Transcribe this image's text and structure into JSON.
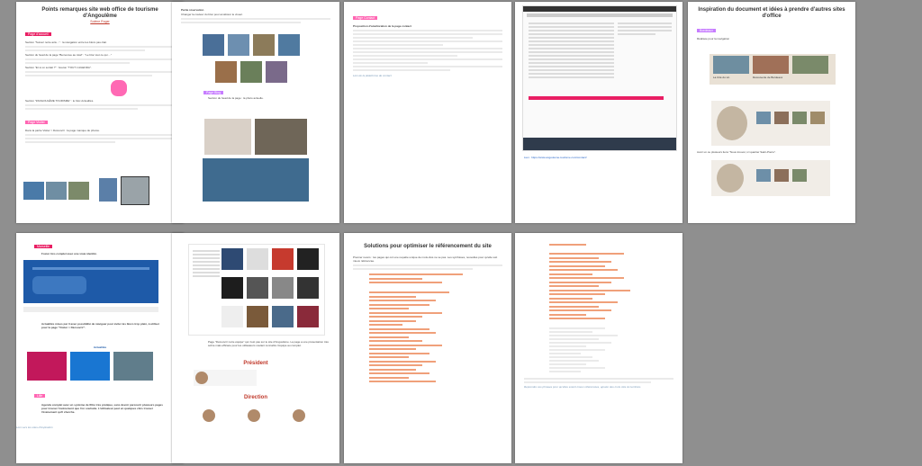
{
  "pages": [
    {
      "title": "Points remarques site web office de tourisme d'Angoulême",
      "author": "Solène Roger",
      "tags": [
        "Page d'accueil",
        "Page Visiter"
      ],
      "paragraphs": [
        "Section \"Suivez notre actu...\" : la navigation entre les blocs pas clair.",
        "Section du head de la page \"Benvenue au total\" : \"Le bloc tout ce qui ...\"",
        "Section \"Et si on sortait ?\" : bouton \"TOUT L'AGENDA\".",
        "Section \"#ANGOULÊME TOURISME\" : le bloc Actualités.",
        "Dans la partie Visiter > Découvrir : la page manque de photos."
      ]
    },
    {
      "heading": "Partie réservation",
      "tag": "Page Blog",
      "paragraphs": [
        "Changer la couleur du bloc pour améliorer le visuel.",
        "Section du head de la page : la photo actuelle."
      ]
    },
    {
      "tag": "Page Contact",
      "heading": "Proposition d'amélioration de la page contact",
      "caption": "Lien de la plateforme de contact"
    },
    {
      "caption": "Lien : https://www.angouleme-tourisme.com/contact/"
    },
    {
      "title": "Inspiration du document et idées à prendre d'autres sites d'office",
      "tag": "Bordeaux",
      "caption": "Réalisée pour la navigation",
      "cards": [
        "La Cité du vin",
        "Découverte de Bordeaux"
      ],
      "note": "Avoir un ou plusieurs liens \"Nous trouver, ici quartier Saint-Pierre\"."
    },
    {
      "tag": "Marseille",
      "heading": "Foster très complet avec une vraie identité.",
      "paragraph": "Actualités mises par 3 avec possibilité de naviguer pour éviter les blocs trop plein, à utiliser pour la page \"Visiter > Découvrir\".",
      "section": "Actualités",
      "tag2": "Lille",
      "paragraph2": "Agenda complet avec un système de filtre très pratique, sans devoir parcourir plusieurs pages pour trouver l'événement que l'on souhaite. L'utilisateur peut en quelques clics trouver l'événement qu'il cherche.",
      "caption": "Lien vers les sites d'inspiration"
    },
    {
      "paragraph": "Page \"Découvrir notre équipe\" qui n'est pas sur le site d'Angoulême. La page a une présentation très sobre mais efficace pour les utilisateurs voulant connaître l'équipe au complet.",
      "section1": "Président",
      "section2": "Direction"
    },
    {
      "title": "Solutions pour optimiser le référencement du site",
      "paragraph": "Premier revers : les pages qui ont une requête unique de mots-clés ne se pas. Les synthèses, nouvelles pour qu'elle soit mieux référencée."
    },
    {
      "note": "Reprendre ces phrases pour qu'elles soient mieux référencées, ajouter des mots clés du territoire."
    }
  ]
}
